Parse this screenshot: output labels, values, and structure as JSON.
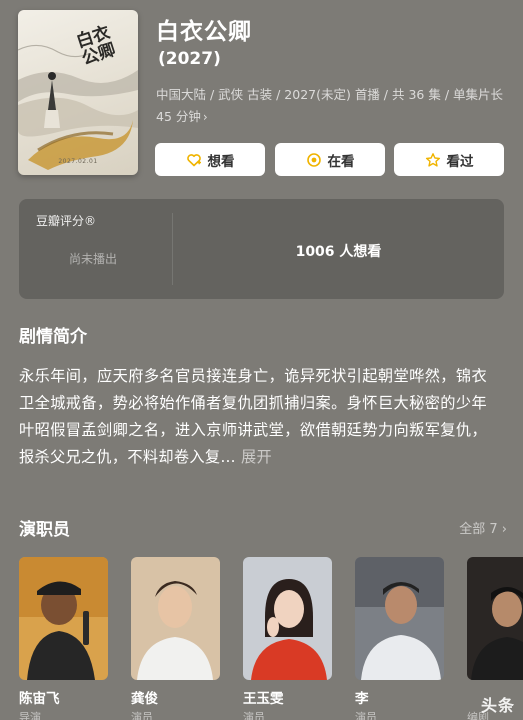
{
  "poster": {
    "title_art": "白衣公卿",
    "date_line": "2027.02.01"
  },
  "show": {
    "title": "白衣公卿",
    "year": "(2027)",
    "meta_line1": "中国大陆 / 武侠 古装 / 2027(未定) 首播 / 共 36 集 / 单集片长",
    "meta_line2": "45 分钟",
    "meta_chevron": "›"
  },
  "actions": {
    "want_label": "想看",
    "doing_label": "在看",
    "done_label": "看过"
  },
  "rating": {
    "label": "豆瓣评分®",
    "status": "尚未播出",
    "want_count": "1006 人想看"
  },
  "synopsis": {
    "title": "剧情简介",
    "text": "永乐年间，应天府多名官员接连身亡，诡异死状引起朝堂哗然，锦衣卫全城戒备，势必将始作俑者复仇团抓捕归案。身怀巨大秘密的少年叶昭假冒孟剑卿之名，进入京师讲武堂，欲借朝廷势力向叛军复仇，报杀父兄之仇，不料却卷入复…",
    "expand_label": "展开"
  },
  "cast": {
    "title": "演职员",
    "all_label": "全部 7 ›",
    "members": [
      {
        "name": "陈宙飞",
        "role": "导演"
      },
      {
        "name": "龚俊",
        "role": "演员"
      },
      {
        "name": "王玉雯",
        "role": "演员"
      },
      {
        "name": "李",
        "role": "演员"
      },
      {
        "name": "",
        "role": "编剧"
      }
    ]
  },
  "watermark": "头条",
  "colors": {
    "background": "#7d7b76",
    "card": "#5c5b58",
    "button": "#ffffff",
    "accent": "#f0b400"
  }
}
